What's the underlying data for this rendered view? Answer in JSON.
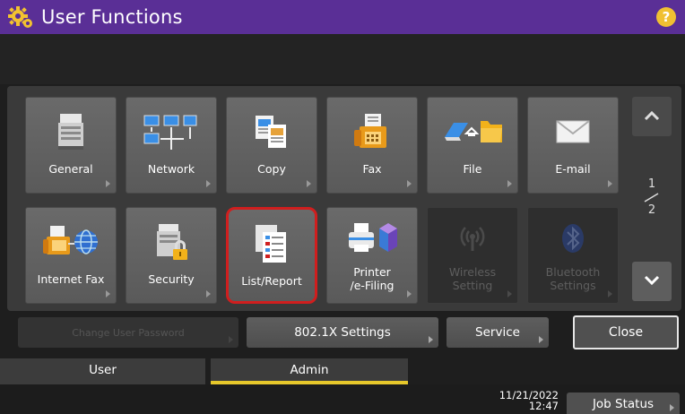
{
  "title": "User Functions",
  "help_label": "?",
  "tiles_row1": [
    {
      "label": "General",
      "icon": "printer-device-icon"
    },
    {
      "label": "Network",
      "icon": "network-computers-icon"
    },
    {
      "label": "Copy",
      "icon": "copy-documents-icon"
    },
    {
      "label": "Fax",
      "icon": "fax-machine-icon"
    },
    {
      "label": "File",
      "icon": "file-folder-icon"
    },
    {
      "label": "E-mail",
      "icon": "envelope-icon"
    }
  ],
  "tiles_row2": [
    {
      "label": "Internet Fax",
      "icon": "internet-fax-icon"
    },
    {
      "label": "Security",
      "icon": "security-lock-icon"
    },
    {
      "label": "List/Report",
      "icon": "list-report-icon"
    },
    {
      "label_line1": "Printer",
      "label_line2": "/e-Filing",
      "icon": "printer-efiling-icon"
    },
    {
      "label_line1": "Wireless",
      "label_line2": "Setting",
      "icon": "wireless-icon"
    },
    {
      "label_line1": "Bluetooth",
      "label_line2": "Settings",
      "icon": "bluetooth-icon"
    }
  ],
  "pager": {
    "current": "1",
    "total": "2"
  },
  "buttons": {
    "change_password": "Change User Password",
    "settings_8021x": "802.1X Settings",
    "service": "Service",
    "close": "Close"
  },
  "tabs": {
    "user": "User",
    "admin": "Admin"
  },
  "status": {
    "date": "11/21/2022",
    "time": "12:47",
    "job_status": "Job Status"
  },
  "colors": {
    "title_bar": "#5a2f96",
    "selected_border": "#d01e1e",
    "active_tab_underline": "#e7c82b"
  }
}
